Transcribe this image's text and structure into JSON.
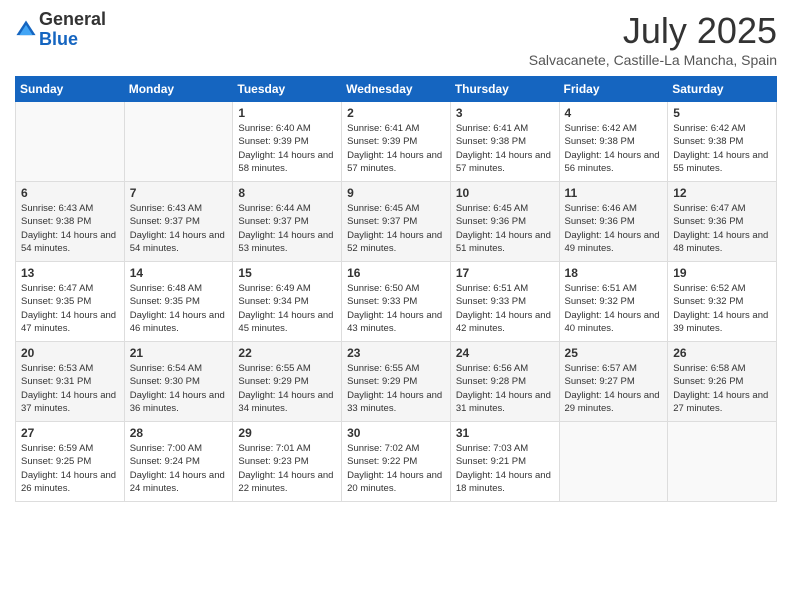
{
  "logo": {
    "general": "General",
    "blue": "Blue"
  },
  "title": "July 2025",
  "location": "Salvacanete, Castille-La Mancha, Spain",
  "weekdays": [
    "Sunday",
    "Monday",
    "Tuesday",
    "Wednesday",
    "Thursday",
    "Friday",
    "Saturday"
  ],
  "weeks": [
    [
      {
        "day": "",
        "sunrise": "",
        "sunset": "",
        "daylight": ""
      },
      {
        "day": "",
        "sunrise": "",
        "sunset": "",
        "daylight": ""
      },
      {
        "day": "1",
        "sunrise": "Sunrise: 6:40 AM",
        "sunset": "Sunset: 9:39 PM",
        "daylight": "Daylight: 14 hours and 58 minutes."
      },
      {
        "day": "2",
        "sunrise": "Sunrise: 6:41 AM",
        "sunset": "Sunset: 9:39 PM",
        "daylight": "Daylight: 14 hours and 57 minutes."
      },
      {
        "day": "3",
        "sunrise": "Sunrise: 6:41 AM",
        "sunset": "Sunset: 9:38 PM",
        "daylight": "Daylight: 14 hours and 57 minutes."
      },
      {
        "day": "4",
        "sunrise": "Sunrise: 6:42 AM",
        "sunset": "Sunset: 9:38 PM",
        "daylight": "Daylight: 14 hours and 56 minutes."
      },
      {
        "day": "5",
        "sunrise": "Sunrise: 6:42 AM",
        "sunset": "Sunset: 9:38 PM",
        "daylight": "Daylight: 14 hours and 55 minutes."
      }
    ],
    [
      {
        "day": "6",
        "sunrise": "Sunrise: 6:43 AM",
        "sunset": "Sunset: 9:38 PM",
        "daylight": "Daylight: 14 hours and 54 minutes."
      },
      {
        "day": "7",
        "sunrise": "Sunrise: 6:43 AM",
        "sunset": "Sunset: 9:37 PM",
        "daylight": "Daylight: 14 hours and 54 minutes."
      },
      {
        "day": "8",
        "sunrise": "Sunrise: 6:44 AM",
        "sunset": "Sunset: 9:37 PM",
        "daylight": "Daylight: 14 hours and 53 minutes."
      },
      {
        "day": "9",
        "sunrise": "Sunrise: 6:45 AM",
        "sunset": "Sunset: 9:37 PM",
        "daylight": "Daylight: 14 hours and 52 minutes."
      },
      {
        "day": "10",
        "sunrise": "Sunrise: 6:45 AM",
        "sunset": "Sunset: 9:36 PM",
        "daylight": "Daylight: 14 hours and 51 minutes."
      },
      {
        "day": "11",
        "sunrise": "Sunrise: 6:46 AM",
        "sunset": "Sunset: 9:36 PM",
        "daylight": "Daylight: 14 hours and 49 minutes."
      },
      {
        "day": "12",
        "sunrise": "Sunrise: 6:47 AM",
        "sunset": "Sunset: 9:36 PM",
        "daylight": "Daylight: 14 hours and 48 minutes."
      }
    ],
    [
      {
        "day": "13",
        "sunrise": "Sunrise: 6:47 AM",
        "sunset": "Sunset: 9:35 PM",
        "daylight": "Daylight: 14 hours and 47 minutes."
      },
      {
        "day": "14",
        "sunrise": "Sunrise: 6:48 AM",
        "sunset": "Sunset: 9:35 PM",
        "daylight": "Daylight: 14 hours and 46 minutes."
      },
      {
        "day": "15",
        "sunrise": "Sunrise: 6:49 AM",
        "sunset": "Sunset: 9:34 PM",
        "daylight": "Daylight: 14 hours and 45 minutes."
      },
      {
        "day": "16",
        "sunrise": "Sunrise: 6:50 AM",
        "sunset": "Sunset: 9:33 PM",
        "daylight": "Daylight: 14 hours and 43 minutes."
      },
      {
        "day": "17",
        "sunrise": "Sunrise: 6:51 AM",
        "sunset": "Sunset: 9:33 PM",
        "daylight": "Daylight: 14 hours and 42 minutes."
      },
      {
        "day": "18",
        "sunrise": "Sunrise: 6:51 AM",
        "sunset": "Sunset: 9:32 PM",
        "daylight": "Daylight: 14 hours and 40 minutes."
      },
      {
        "day": "19",
        "sunrise": "Sunrise: 6:52 AM",
        "sunset": "Sunset: 9:32 PM",
        "daylight": "Daylight: 14 hours and 39 minutes."
      }
    ],
    [
      {
        "day": "20",
        "sunrise": "Sunrise: 6:53 AM",
        "sunset": "Sunset: 9:31 PM",
        "daylight": "Daylight: 14 hours and 37 minutes."
      },
      {
        "day": "21",
        "sunrise": "Sunrise: 6:54 AM",
        "sunset": "Sunset: 9:30 PM",
        "daylight": "Daylight: 14 hours and 36 minutes."
      },
      {
        "day": "22",
        "sunrise": "Sunrise: 6:55 AM",
        "sunset": "Sunset: 9:29 PM",
        "daylight": "Daylight: 14 hours and 34 minutes."
      },
      {
        "day": "23",
        "sunrise": "Sunrise: 6:55 AM",
        "sunset": "Sunset: 9:29 PM",
        "daylight": "Daylight: 14 hours and 33 minutes."
      },
      {
        "day": "24",
        "sunrise": "Sunrise: 6:56 AM",
        "sunset": "Sunset: 9:28 PM",
        "daylight": "Daylight: 14 hours and 31 minutes."
      },
      {
        "day": "25",
        "sunrise": "Sunrise: 6:57 AM",
        "sunset": "Sunset: 9:27 PM",
        "daylight": "Daylight: 14 hours and 29 minutes."
      },
      {
        "day": "26",
        "sunrise": "Sunrise: 6:58 AM",
        "sunset": "Sunset: 9:26 PM",
        "daylight": "Daylight: 14 hours and 27 minutes."
      }
    ],
    [
      {
        "day": "27",
        "sunrise": "Sunrise: 6:59 AM",
        "sunset": "Sunset: 9:25 PM",
        "daylight": "Daylight: 14 hours and 26 minutes."
      },
      {
        "day": "28",
        "sunrise": "Sunrise: 7:00 AM",
        "sunset": "Sunset: 9:24 PM",
        "daylight": "Daylight: 14 hours and 24 minutes."
      },
      {
        "day": "29",
        "sunrise": "Sunrise: 7:01 AM",
        "sunset": "Sunset: 9:23 PM",
        "daylight": "Daylight: 14 hours and 22 minutes."
      },
      {
        "day": "30",
        "sunrise": "Sunrise: 7:02 AM",
        "sunset": "Sunset: 9:22 PM",
        "daylight": "Daylight: 14 hours and 20 minutes."
      },
      {
        "day": "31",
        "sunrise": "Sunrise: 7:03 AM",
        "sunset": "Sunset: 9:21 PM",
        "daylight": "Daylight: 14 hours and 18 minutes."
      },
      {
        "day": "",
        "sunrise": "",
        "sunset": "",
        "daylight": ""
      },
      {
        "day": "",
        "sunrise": "",
        "sunset": "",
        "daylight": ""
      }
    ]
  ]
}
